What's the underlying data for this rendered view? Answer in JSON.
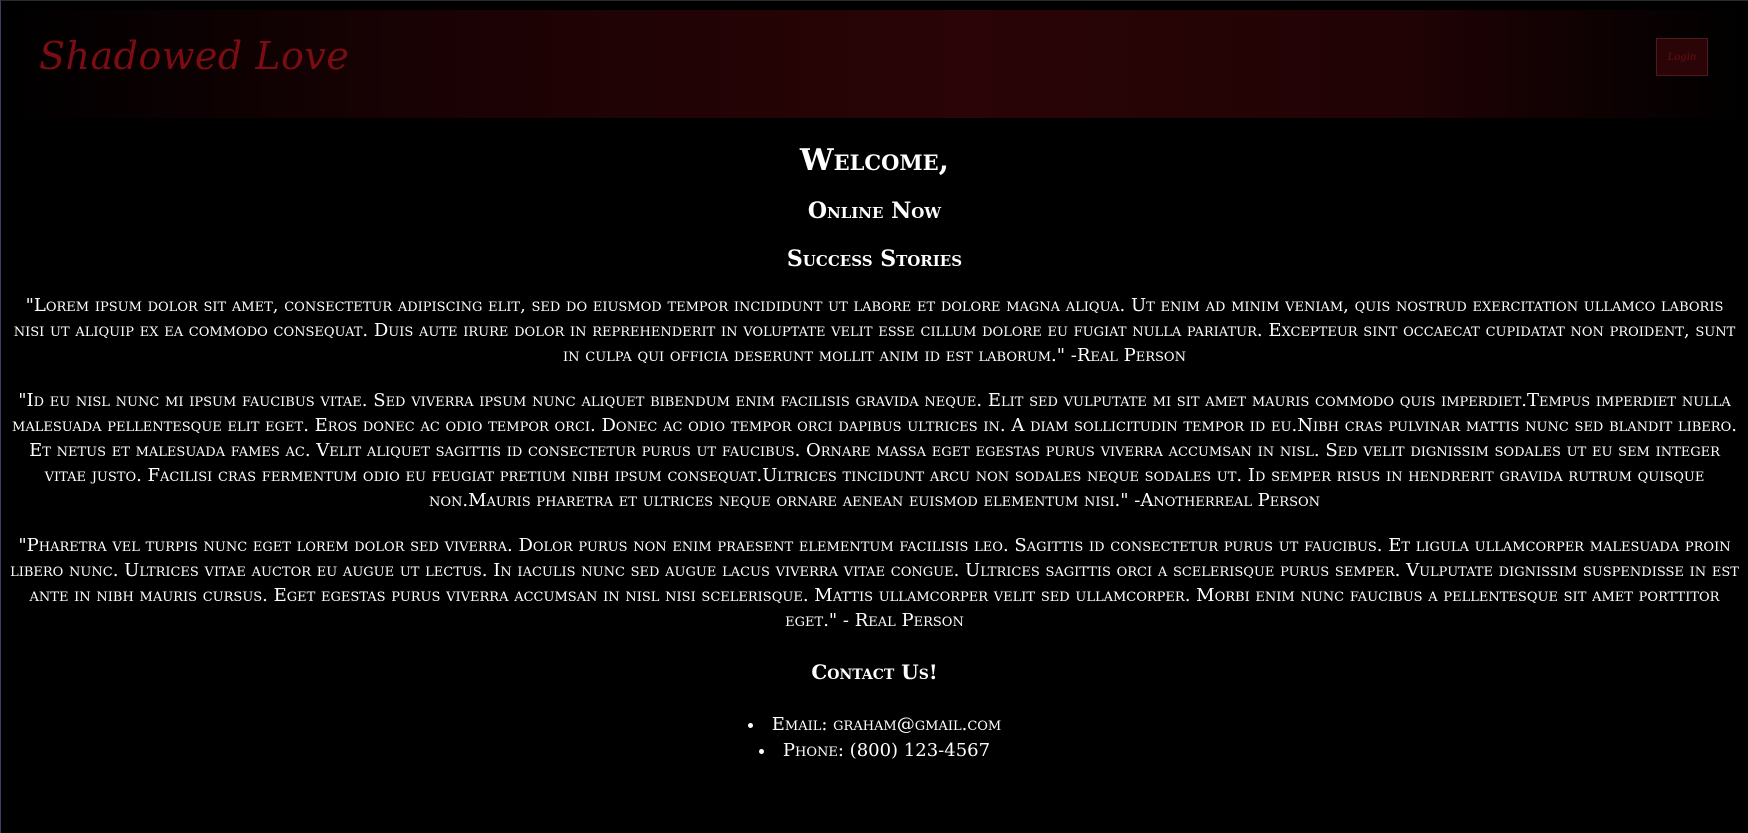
{
  "header": {
    "logo": "Shadowed Love",
    "login_label": "Login"
  },
  "main": {
    "welcome": "Welcome,",
    "online_now": "Online Now",
    "success_stories_title": "Success Stories",
    "stories": [
      "\"Lorem ipsum dolor sit amet, consectetur adipiscing elit, sed do eiusmod tempor incididunt ut labore et dolore magna aliqua. Ut enim ad minim veniam, quis nostrud exercitation ullamco laboris nisi ut aliquip ex ea commodo consequat. Duis aute irure dolor in reprehenderit in voluptate velit esse cillum dolore eu fugiat nulla pariatur. Excepteur sint occaecat cupidatat non proident, sunt in culpa qui officia deserunt mollit anim id est laborum.\" -Real Person",
      "\"Id eu nisl nunc mi ipsum faucibus vitae. Sed viverra ipsum nunc aliquet bibendum enim facilisis gravida neque. Elit sed vulputate mi sit amet mauris commodo quis imperdiet.Tempus imperdiet nulla malesuada pellentesque elit eget. Eros donec ac odio tempor orci. Donec ac odio tempor orci dapibus ultrices in. A diam sollicitudin tempor id eu.Nibh cras pulvinar mattis nunc sed blandit libero. Et netus et malesuada fames ac. Velit aliquet sagittis id consectetur purus ut faucibus. Ornare massa eget egestas purus viverra accumsan in nisl. Sed velit dignissim sodales ut eu sem integer vitae justo. Facilisi cras fermentum odio eu feugiat pretium nibh ipsum consequat.Ultrices tincidunt arcu non sodales neque sodales ut. Id semper risus in hendrerit gravida rutrum quisque non.Mauris pharetra et ultrices neque ornare aenean euismod elementum nisi.\" -Anotherreal Person",
      "\"Pharetra vel turpis nunc eget lorem dolor sed viverra. Dolor purus non enim praesent elementum facilisis leo. Sagittis id consectetur purus ut faucibus. Et ligula ullamcorper malesuada proin libero nunc. Ultrices vitae auctor eu augue ut lectus. In iaculis nunc sed augue lacus viverra vitae congue. Ultrices sagittis orci a scelerisque purus semper. Vulputate dignissim suspendisse in est ante in nibh mauris cursus. Eget egestas purus viverra accumsan in nisl nisi scelerisque. Mattis ullamcorper velit sed ullamcorper. Morbi enim nunc faucibus a pellentesque sit amet porttitor eget.\" - Real Person"
    ],
    "contact_title": "Contact Us!",
    "contact": {
      "email": "Email: graham@gmail.com",
      "phone": "Phone: (800) 123-4567"
    }
  },
  "colors": {
    "background": "#000000",
    "logo": "#7a0c12",
    "header_accent": "#2a0406",
    "text": "#ffffff"
  }
}
